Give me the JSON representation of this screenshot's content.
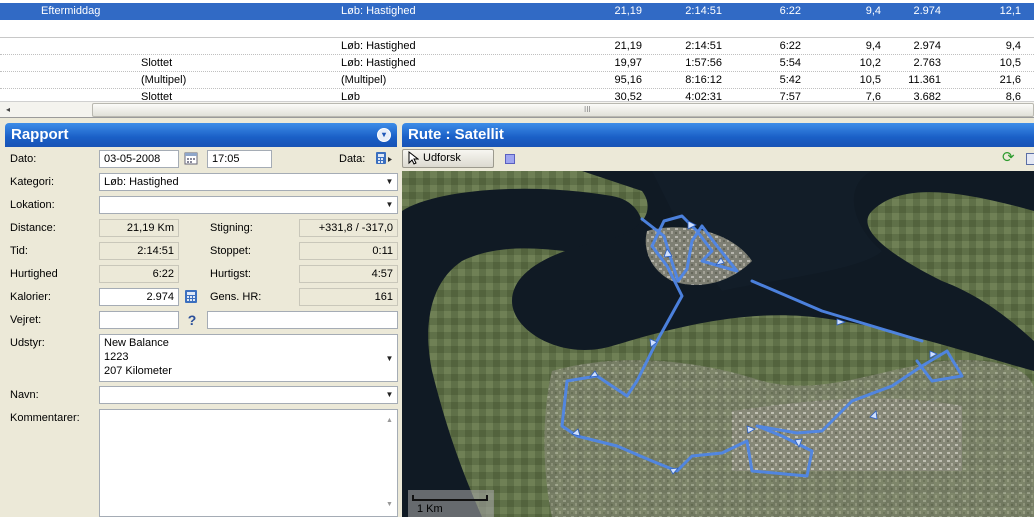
{
  "grid": {
    "selected_row": {
      "name": "Eftermiddag",
      "category": "Løb: Hastighed",
      "distance": "21,19",
      "time": "2:14:51",
      "pace": "6:22",
      "speed": "9,4",
      "calories": "2.974",
      "last": "12,1"
    },
    "rows": [
      {
        "location": "",
        "category": "Løb: Hastighed",
        "distance": "21,19",
        "time": "2:14:51",
        "pace": "6:22",
        "speed": "9,4",
        "calories": "2.974",
        "last": "9,4"
      },
      {
        "location": "Slottet",
        "category": "Løb: Hastighed",
        "distance": "19,97",
        "time": "1:57:56",
        "pace": "5:54",
        "speed": "10,2",
        "calories": "2.763",
        "last": "10,5"
      },
      {
        "location": "(Multipel)",
        "category": "(Multipel)",
        "distance": "95,16",
        "time": "8:16:12",
        "pace": "5:42",
        "speed": "10,5",
        "calories": "11.361",
        "last": "21,6"
      },
      {
        "location": "Slottet",
        "category": "Løb",
        "distance": "30,52",
        "time": "4:02:31",
        "pace": "7:57",
        "speed": "7,6",
        "calories": "3.682",
        "last": "8,6"
      }
    ],
    "scroll_left": "◂",
    "scroll_grip": "III"
  },
  "report": {
    "title": "Rapport",
    "collapse": "▾",
    "date_label": "Dato:",
    "date_value": "03-05-2008",
    "time_value": "17:05",
    "data_label": "Data:",
    "category_label": "Kategori:",
    "category_value": "Løb: Hastighed",
    "location_label": "Lokation:",
    "location_value": "",
    "distance_label": "Distance:",
    "distance_value": "21,19 Km",
    "ascent_label": "Stigning:",
    "ascent_value": "+331,8 / -317,0",
    "time_label": "Tid:",
    "time_total": "2:14:51",
    "stopped_label": "Stoppet:",
    "stopped_value": "0:11",
    "speed_label": "Hurtighed",
    "speed_value": "6:22",
    "fastest_label": "Hurtigst:",
    "fastest_value": "4:57",
    "calories_label": "Kalorier:",
    "calories_value": "2.974",
    "avg_hr_label": "Gens. HR:",
    "avg_hr_value": "161",
    "weather_label": "Vejret:",
    "weather_value": "",
    "weather_extra": "",
    "equipment_label": "Udstyr:",
    "equipment_lines": [
      "New Balance",
      "1223",
      "207 Kilometer"
    ],
    "name_label": "Navn:",
    "name_value": "",
    "comments_label": "Kommentarer:",
    "comments_value": "",
    "help_glyph": "?"
  },
  "route": {
    "title": "Rute : Satellit",
    "explore_label": "Udforsk",
    "refresh_glyph": "⟳",
    "scale_label": "1 Km"
  }
}
